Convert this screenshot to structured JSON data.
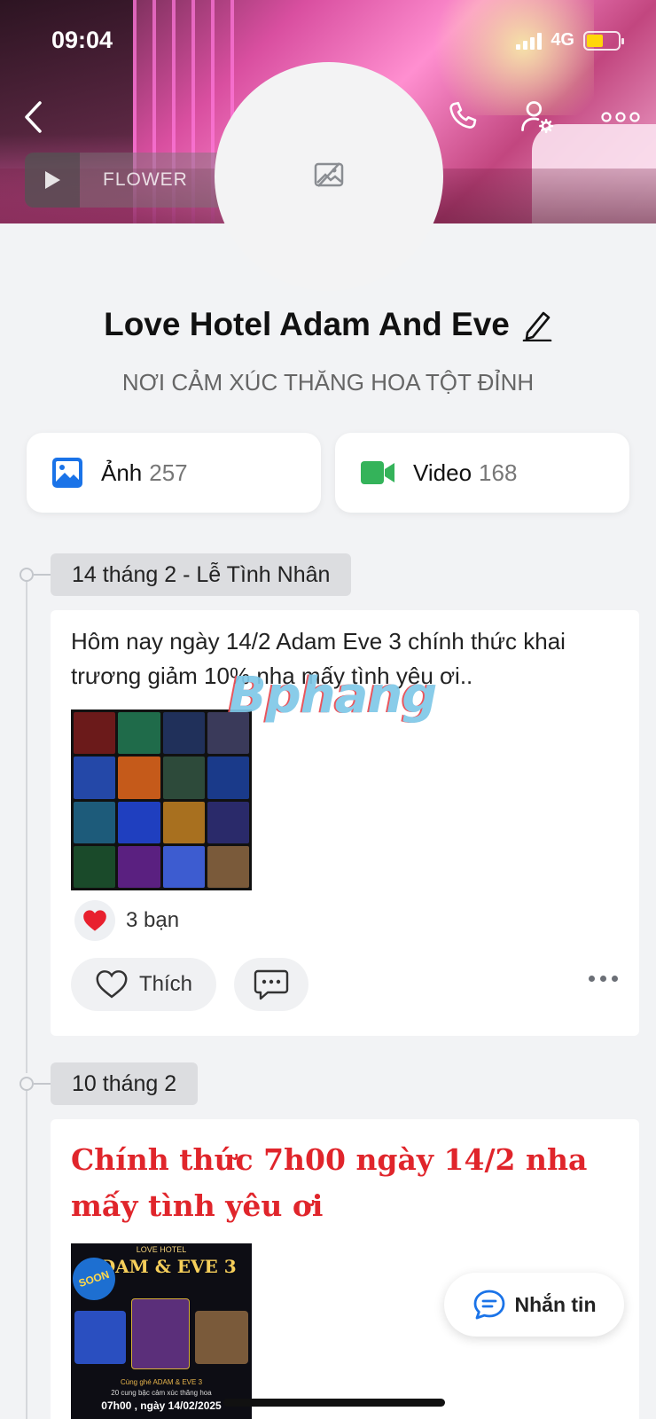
{
  "status_bar": {
    "time": "09:04",
    "network": "4G"
  },
  "cover": {
    "music_label": "FLOWER"
  },
  "profile": {
    "name": "Love Hotel Adam And Eve",
    "subtitle": "NƠI CẢM XÚC THĂNG HOA TỘT ĐỈNH"
  },
  "media": {
    "photos": {
      "label": "Ảnh",
      "count": "257"
    },
    "videos": {
      "label": "Video",
      "count": "168"
    }
  },
  "posts": [
    {
      "date": "14 tháng 2 - Lễ Tình Nhân",
      "text": "Hôm nay ngày 14/2 Adam Eve 3 chính thức khai trương giảm 10% nha mấy tình yêu ơi..",
      "reactions": "3 bạn",
      "like_label": "Thích"
    },
    {
      "date": "10 tháng 2",
      "text": "Chính thức 7h00 ngày 14/2 nha mấy tình yêu ơi",
      "poster": {
        "brand": "LOVE HOTEL",
        "title": "ADAM & EVE 3",
        "badge": "SOON",
        "line1": "Cùng ghé ADAM & EVE 3",
        "line2": "20 cung bậc cảm xúc thăng hoa",
        "time": "07h00 , ngày 14/02/2025"
      }
    }
  ],
  "watermark": "Bphang",
  "message_button": "Nhắn tin",
  "colors": {
    "accent": "#1a73e8",
    "video_green": "#34b35a",
    "heart": "#e8202e",
    "post_title_red": "#e0252b"
  }
}
